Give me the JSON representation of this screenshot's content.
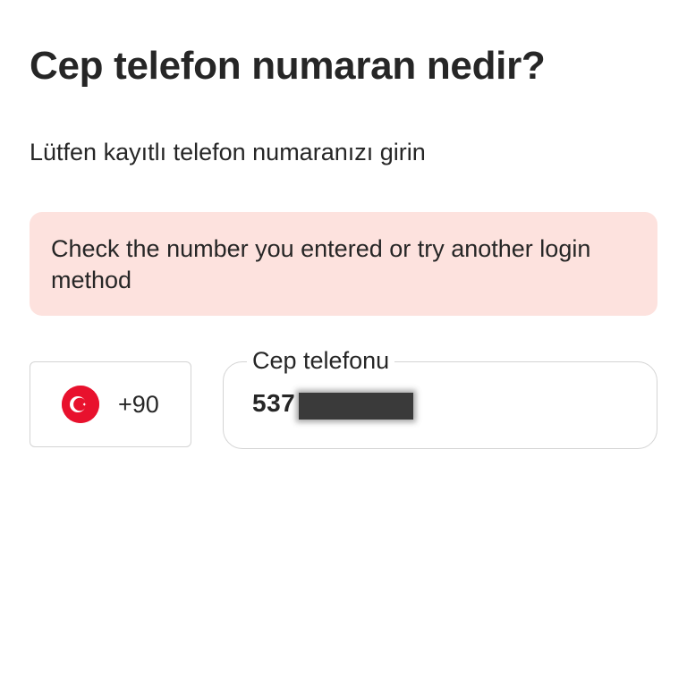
{
  "header": {
    "title": "Cep telefon numaran nedir?",
    "subtitle": "Lütfen kayıtlı telefon numaranızı girin"
  },
  "error": {
    "message": "Check the number you entered or try another login method",
    "background_color": "#fde2de"
  },
  "country": {
    "flag_icon": "turkey-flag-icon",
    "dial_code": "+90",
    "flag_color": "#e8112d"
  },
  "phone": {
    "label": "Cep telefonu",
    "value": "537"
  }
}
